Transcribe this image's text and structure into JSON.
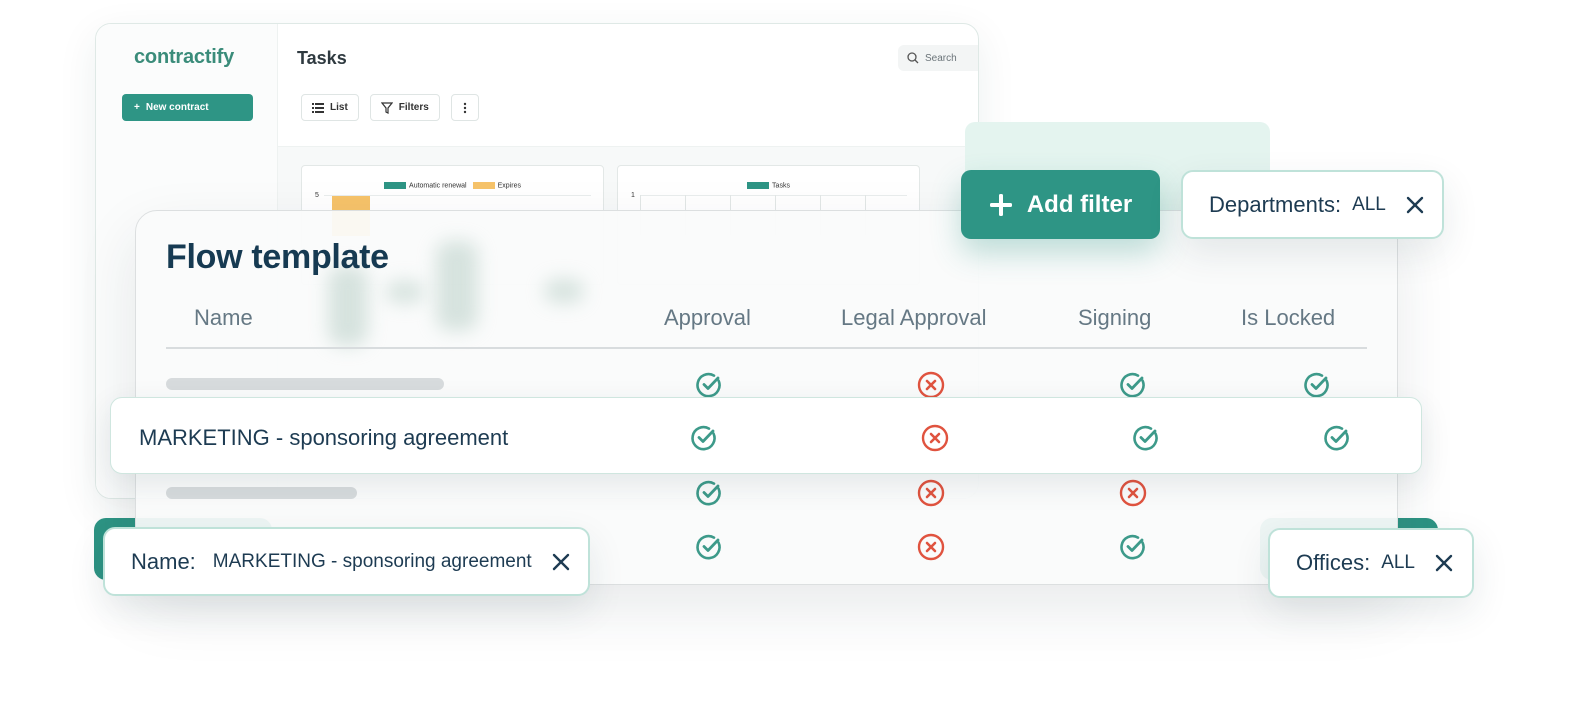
{
  "app": {
    "logo": "contractify",
    "new_contract_label": "New contract",
    "title": "Tasks",
    "search_placeholder": "Search",
    "toolbar": {
      "list_label": "List",
      "filters_label": "Filters"
    },
    "chart1_legend": [
      "Automatic renewal",
      "Expires"
    ],
    "chart1_axis_value": "5",
    "chart2_legend": [
      "Tasks"
    ],
    "chart2_axis_value": "1"
  },
  "flow": {
    "title": "Flow template",
    "columns": [
      "Name",
      "Approval",
      "Legal Approval",
      "Signing",
      "Is Locked"
    ],
    "rows": [
      {
        "name": null,
        "approval": true,
        "legal_approval": false,
        "signing": true,
        "is_locked": true
      },
      {
        "name": "MARKETING - sponsoring agreement",
        "approval": true,
        "legal_approval": false,
        "signing": true,
        "is_locked": true
      },
      {
        "name": null,
        "approval": true,
        "legal_approval": false,
        "signing": false,
        "is_locked": null
      },
      {
        "name": null,
        "approval": true,
        "legal_approval": false,
        "signing": true,
        "is_locked": null
      }
    ]
  },
  "filters": {
    "add_filter_label": "Add filter",
    "departments": {
      "label": "Departments:",
      "value": "ALL"
    },
    "name": {
      "label": "Name:",
      "value": "MARKETING - sponsoring agreement"
    },
    "offices": {
      "label": "Offices:",
      "value": "ALL"
    }
  },
  "colors": {
    "accent": "#2e9585",
    "check": "#3d9a8a",
    "cross": "#e0533f",
    "chart_teal": "#2e9585",
    "chart_yellow": "#f6c36a"
  }
}
